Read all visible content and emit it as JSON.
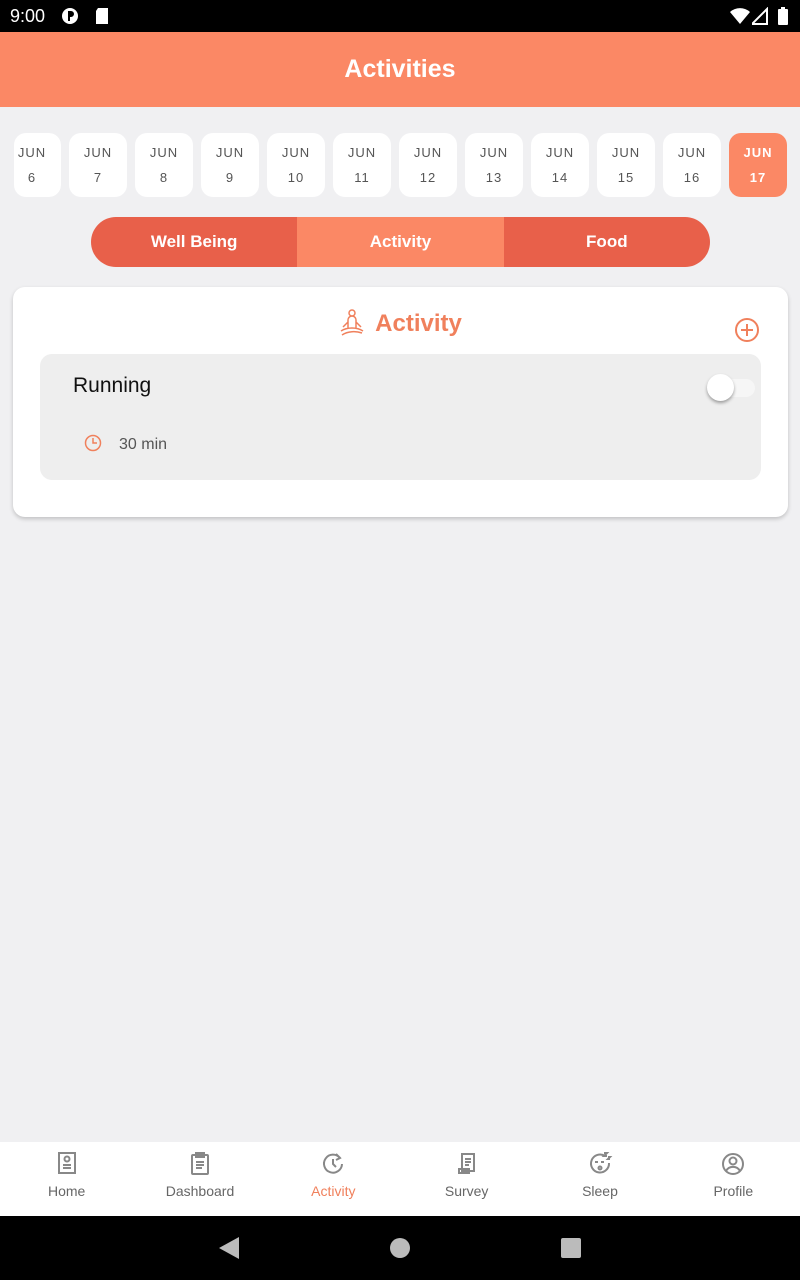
{
  "status_bar": {
    "time": "9:00"
  },
  "header": {
    "title": "Activities"
  },
  "dates": [
    {
      "month": "JUN",
      "day": "6"
    },
    {
      "month": "JUN",
      "day": "7"
    },
    {
      "month": "JUN",
      "day": "8"
    },
    {
      "month": "JUN",
      "day": "9"
    },
    {
      "month": "JUN",
      "day": "10"
    },
    {
      "month": "JUN",
      "day": "11"
    },
    {
      "month": "JUN",
      "day": "12"
    },
    {
      "month": "JUN",
      "day": "13"
    },
    {
      "month": "JUN",
      "day": "14"
    },
    {
      "month": "JUN",
      "day": "15"
    },
    {
      "month": "JUN",
      "day": "16"
    },
    {
      "month": "JUN",
      "day": "17",
      "selected": true
    }
  ],
  "segments": [
    {
      "label": "Well Being"
    },
    {
      "label": "Activity",
      "selected": true
    },
    {
      "label": "Food"
    }
  ],
  "card": {
    "title": "Activity",
    "icon": "meditation-icon",
    "add_icon": "add-circle-icon",
    "items": [
      {
        "name": "Running",
        "duration": "30 min",
        "toggle_on": false
      }
    ]
  },
  "bottom_nav": [
    {
      "label": "Home",
      "icon": "home-book-icon"
    },
    {
      "label": "Dashboard",
      "icon": "clipboard-icon"
    },
    {
      "label": "Activity",
      "icon": "clock-refresh-icon",
      "active": true
    },
    {
      "label": "Survey",
      "icon": "receipt-icon"
    },
    {
      "label": "Sleep",
      "icon": "sleep-face-icon"
    },
    {
      "label": "Profile",
      "icon": "user-circle-icon"
    }
  ],
  "colors": {
    "accent": "#fb8865",
    "segment": "#e8604a",
    "active_text": "#f0805c"
  }
}
